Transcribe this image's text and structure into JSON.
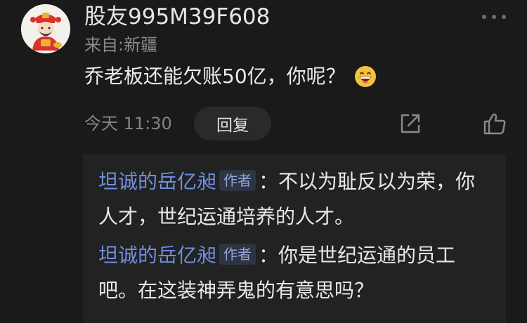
{
  "comment": {
    "username": "股友995M39F608",
    "location": "来自:新疆",
    "text": "乔老板还能欠账50亿，你呢？",
    "emoji": "grinning-face-emoji",
    "time": "今天 11:30",
    "reply_button": "回复"
  },
  "replies": [
    {
      "author": "坦诚的岳亿昶",
      "badge": "作者",
      "separator": "：",
      "text": "不以为耻反以为荣，你人才，世纪运通培养的人才。"
    },
    {
      "author": "坦诚的岳亿昶",
      "badge": "作者",
      "separator": "：",
      "text": "你是世纪运通的员工吧。在这装神弄鬼的有意思吗？"
    }
  ],
  "icons": {
    "more": "more-dots-icon",
    "share": "share-icon",
    "like": "thumbs-up-icon"
  },
  "colors": {
    "background": "#1a1a1a",
    "reply_panel": "#222222",
    "author_link": "#6f8fe0"
  }
}
